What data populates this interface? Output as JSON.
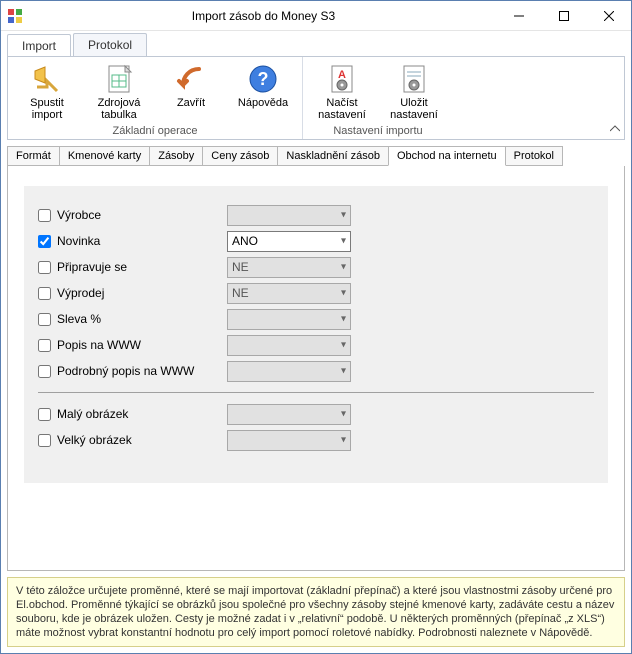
{
  "window": {
    "title": "Import zásob do Money S3"
  },
  "primary_tabs": [
    {
      "label": "Import",
      "active": true
    },
    {
      "label": "Protokol",
      "active": false
    }
  ],
  "ribbon": {
    "groups": [
      {
        "caption": "Základní operace",
        "buttons": [
          {
            "label": "Spustit\nimport",
            "icon": "run-import-icon"
          },
          {
            "label": "Zdrojová\ntabulka",
            "icon": "source-table-icon"
          },
          {
            "label": "Zavřít",
            "icon": "close-arrow-icon"
          },
          {
            "label": "Nápověda",
            "icon": "help-icon"
          }
        ]
      },
      {
        "caption": "Nastavení importu",
        "buttons": [
          {
            "label": "Načíst\nnastavení",
            "icon": "load-settings-icon"
          },
          {
            "label": "Uložit\nnastavení",
            "icon": "save-settings-icon"
          }
        ]
      }
    ]
  },
  "sub_tabs": [
    "Formát",
    "Kmenové karty",
    "Zásoby",
    "Ceny zásob",
    "Naskladnění zásob",
    "Obchod na internetu",
    "Protokol"
  ],
  "sub_tab_active": 5,
  "form": {
    "rows": [
      {
        "key": "vyrobce",
        "label": "Výrobce",
        "checked": false,
        "value": "",
        "enabled": false
      },
      {
        "key": "novinka",
        "label": "Novinka",
        "checked": true,
        "value": "ANO",
        "enabled": true
      },
      {
        "key": "pripravuje",
        "label": "Připravuje se",
        "checked": false,
        "value": "NE",
        "enabled": false
      },
      {
        "key": "vyprodej",
        "label": "Výprodej",
        "checked": false,
        "value": "NE",
        "enabled": false
      },
      {
        "key": "sleva",
        "label": "Sleva %",
        "checked": false,
        "value": "",
        "enabled": false
      },
      {
        "key": "popiswww",
        "label": "Popis na WWW",
        "checked": false,
        "value": "",
        "enabled": false
      },
      {
        "key": "podrobny",
        "label": "Podrobný popis na WWW",
        "checked": false,
        "value": "",
        "enabled": false
      }
    ],
    "rows2": [
      {
        "key": "maly",
        "label": "Malý obrázek",
        "checked": false,
        "value": "",
        "enabled": false
      },
      {
        "key": "velky",
        "label": "Velký obrázek",
        "checked": false,
        "value": "",
        "enabled": false
      }
    ]
  },
  "hint": "V této záložce určujete proměnné, které se mají importovat (základní přepínač) a které jsou vlastnostmi zásoby určené pro El.obchod. Proměnné týkající se obrázků jsou společné pro všechny zásoby stejné kmenové karty, zadáváte cestu a název souboru, kde je obrázek uložen. Cesty je možné zadat i v „relativní“ podobě. U některých proměnných (přepínač „z XLS“) máte možnost vybrat konstantní hodnotu pro celý import pomocí roletové nabídky. Podrobnosti naleznete v Nápovědě."
}
